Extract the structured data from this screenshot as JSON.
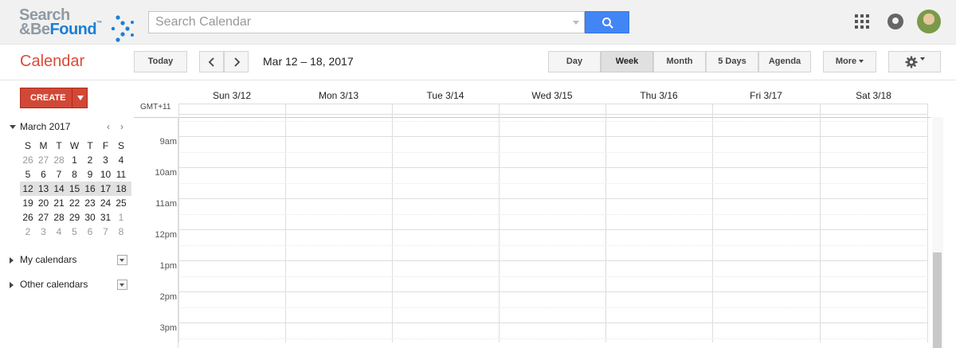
{
  "header": {
    "logo_line1": "Search",
    "logo_line2_part1": "&Be",
    "logo_line2_part2": "Found",
    "logo_tm": "™",
    "search_placeholder": "Search Calendar"
  },
  "toolbar": {
    "app_title": "Calendar",
    "today_label": "Today",
    "date_range": "Mar 12 – 18, 2017",
    "views": [
      "Day",
      "Week",
      "Month",
      "5 Days",
      "Agenda"
    ],
    "active_view": "Week",
    "more_label": "More"
  },
  "sidebar": {
    "create_label": "CREATE",
    "mini_month": "March 2017",
    "weekday_heads": [
      "S",
      "M",
      "T",
      "W",
      "T",
      "F",
      "S"
    ],
    "weeks": [
      [
        "26",
        "27",
        "28",
        "1",
        "2",
        "3",
        "4"
      ],
      [
        "5",
        "6",
        "7",
        "8",
        "9",
        "10",
        "11"
      ],
      [
        "12",
        "13",
        "14",
        "15",
        "16",
        "17",
        "18"
      ],
      [
        "19",
        "20",
        "21",
        "22",
        "23",
        "24",
        "25"
      ],
      [
        "26",
        "27",
        "28",
        "29",
        "30",
        "31",
        "1"
      ],
      [
        "2",
        "3",
        "4",
        "5",
        "6",
        "7",
        "8"
      ]
    ],
    "my_calendars": "My calendars",
    "other_calendars": "Other calendars"
  },
  "week": {
    "timezone": "GMT+11",
    "days": [
      "Sun 3/12",
      "Mon 3/13",
      "Tue 3/14",
      "Wed 3/15",
      "Thu 3/16",
      "Fri 3/17",
      "Sat 3/18"
    ],
    "hours": [
      "9am",
      "10am",
      "11am",
      "12pm",
      "1pm",
      "2pm",
      "3pm"
    ]
  },
  "colors": {
    "brand_red": "#dd4b39",
    "search_blue": "#4285f4",
    "create_red": "#d14836"
  }
}
